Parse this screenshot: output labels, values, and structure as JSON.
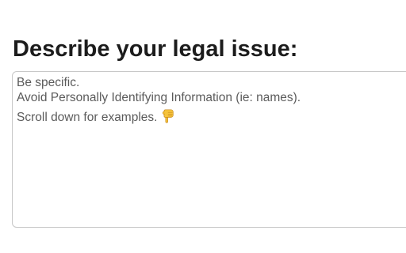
{
  "form": {
    "heading": "Describe your legal issue:",
    "textarea": {
      "value": "",
      "placeholder_lines": [
        "Be specific.",
        "Avoid Personally Identifying Information (ie: names).",
        "Scroll down for examples."
      ],
      "placeholder_emoji_icon": "pointing-down-hand-emoji",
      "placeholder_color": "#5b5b5b",
      "border_color": "#c7c7c7"
    }
  }
}
